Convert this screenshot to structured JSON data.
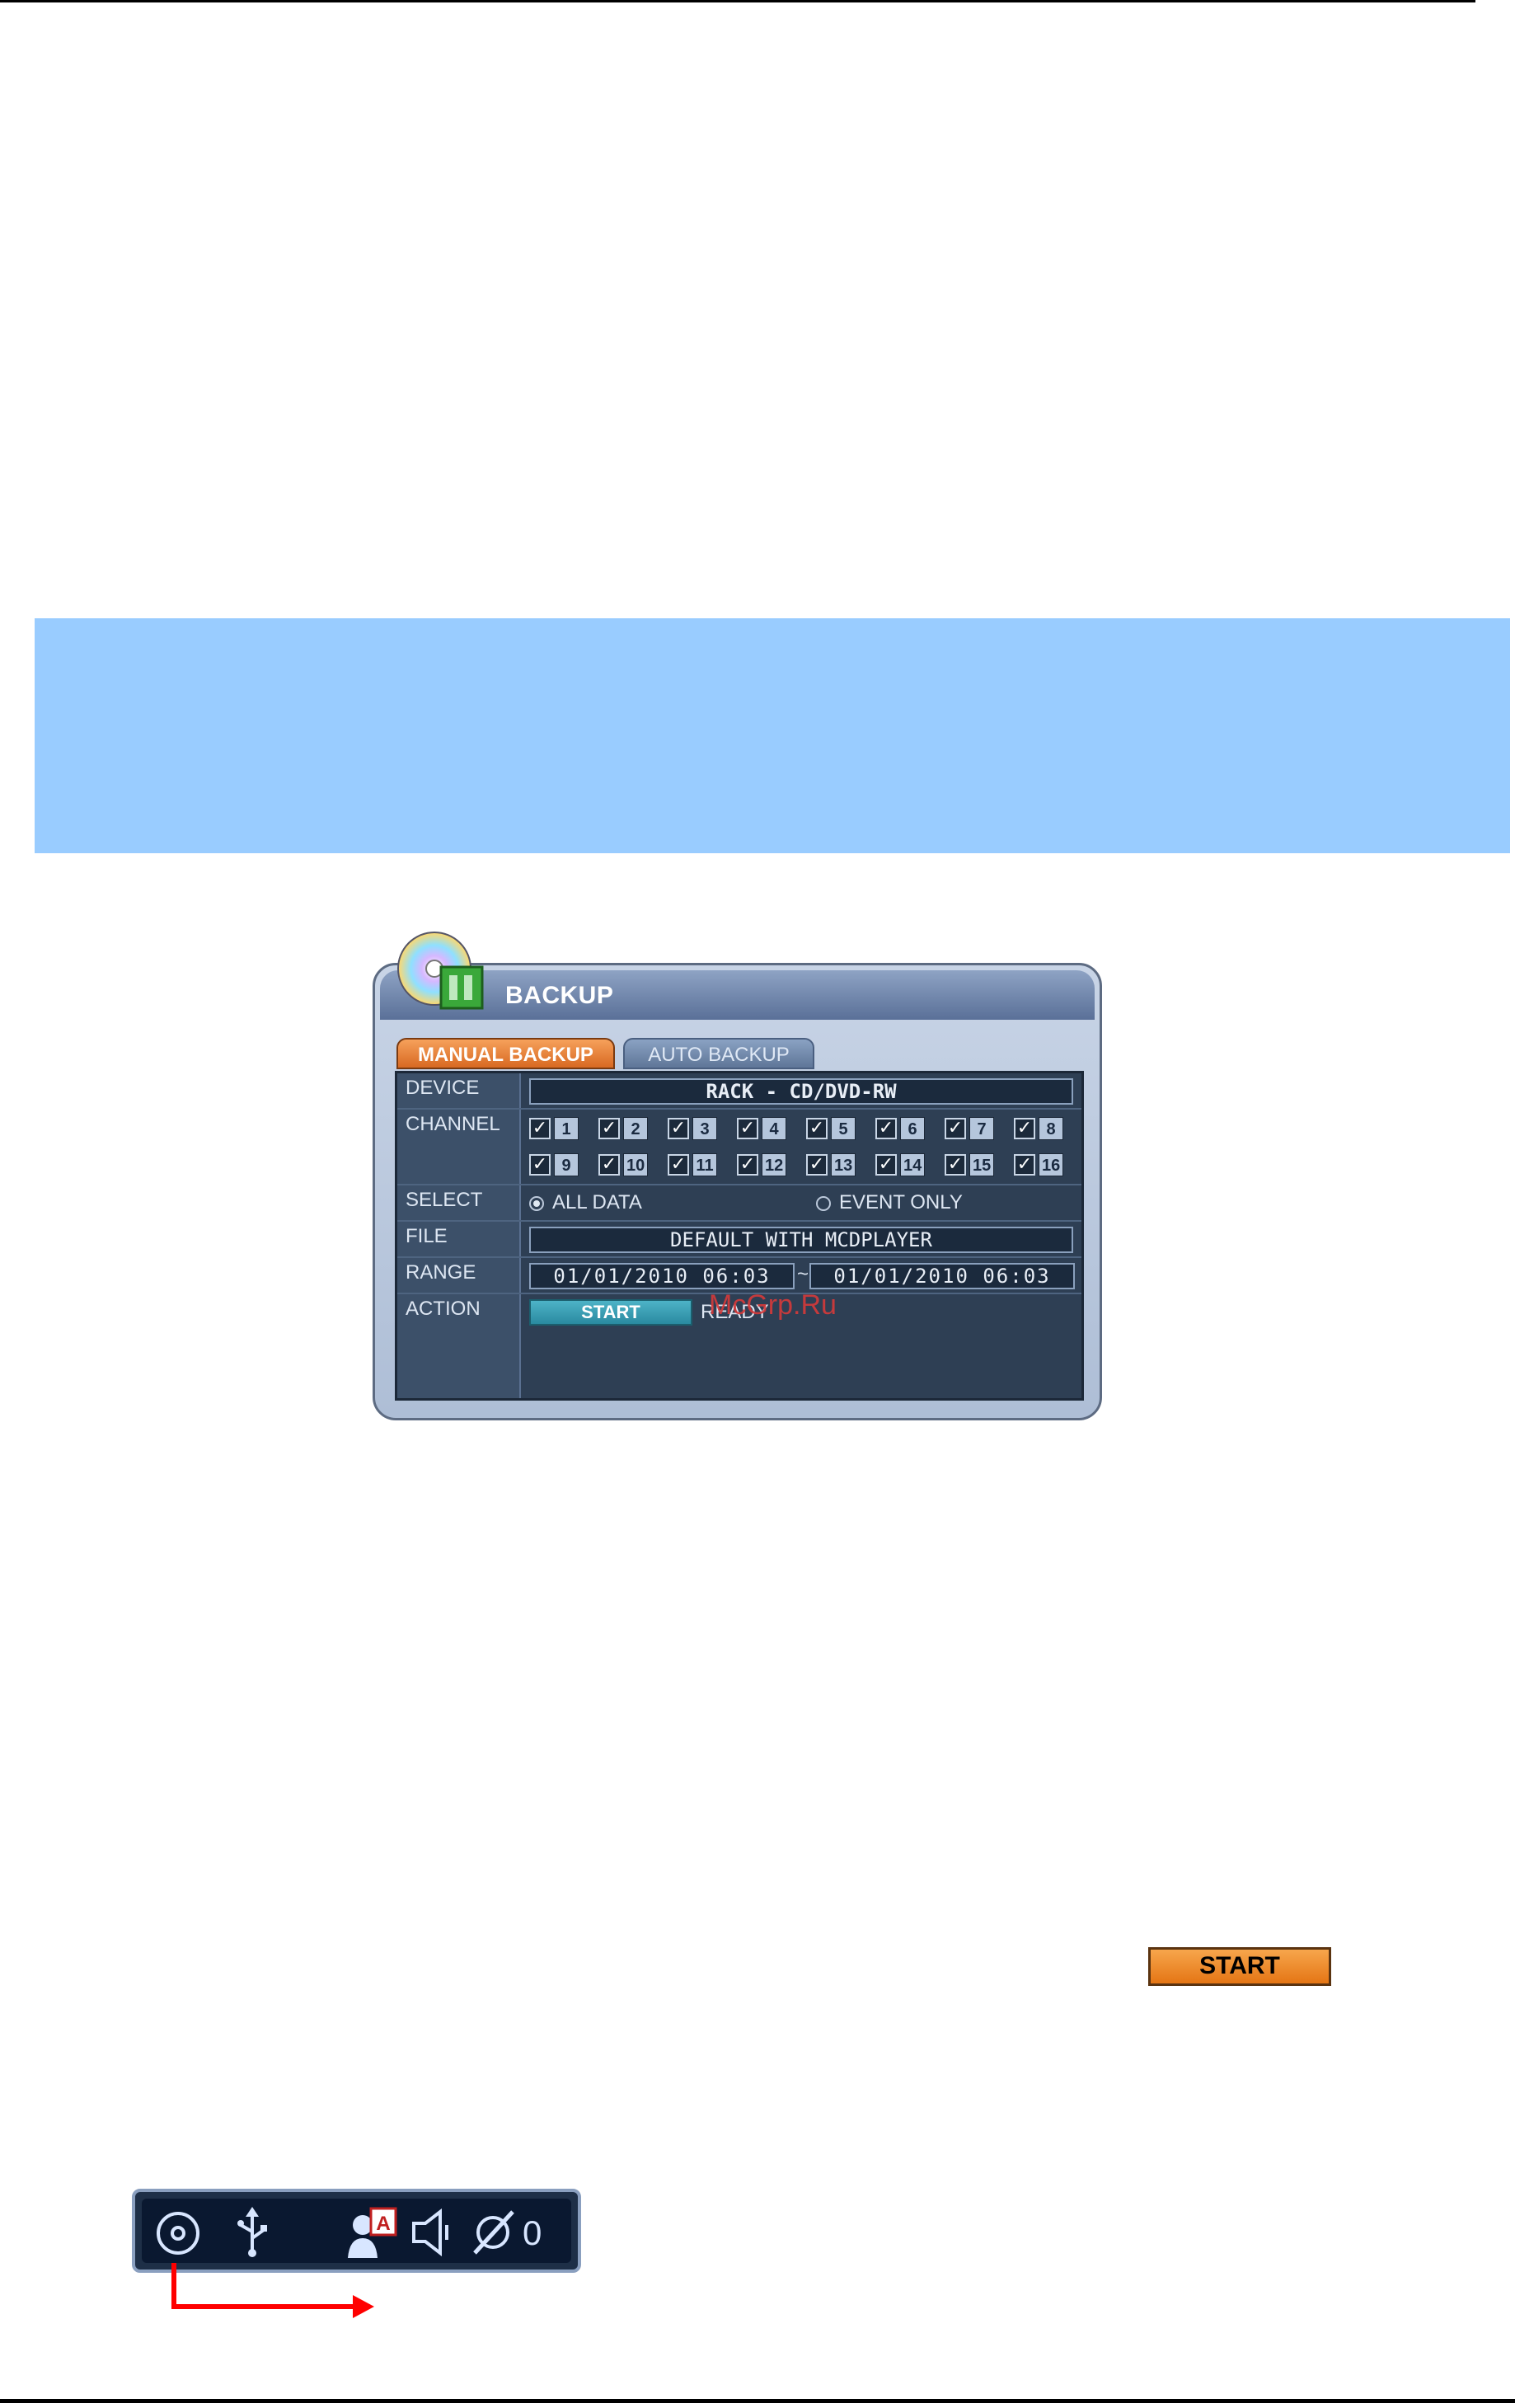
{
  "backup": {
    "title": "BACKUP",
    "tabs": [
      "MANUAL BACKUP",
      "AUTO BACKUP"
    ],
    "labels": {
      "device": "DEVICE",
      "channel": "CHANNEL",
      "select": "SELECT",
      "file": "FILE",
      "range": "RANGE",
      "action": "ACTION"
    },
    "device_value": "RACK - CD/DVD-RW",
    "channels": [
      "1",
      "2",
      "3",
      "4",
      "5",
      "6",
      "7",
      "8",
      "9",
      "10",
      "11",
      "12",
      "13",
      "14",
      "15",
      "16"
    ],
    "select_options": [
      "ALL DATA",
      "EVENT ONLY"
    ],
    "select_selected": "ALL DATA",
    "file_value": "DEFAULT WITH MCDPLAYER",
    "range_start": "01/01/2010 06:03",
    "range_separator": "~",
    "range_end": "01/01/2010 06:03",
    "action_button": "START",
    "action_status": "READY",
    "watermark": "McGrp.Ru"
  },
  "start_button_label": "START",
  "statusbar": {
    "icons": [
      "disc-icon",
      "usb-icon",
      "user-alert-icon",
      "speaker-icon",
      "mute-icon"
    ],
    "count": "0"
  },
  "colors": {
    "note_band": "#99ccff",
    "accent_orange": "#e47514",
    "arrow": "#ff0000"
  }
}
